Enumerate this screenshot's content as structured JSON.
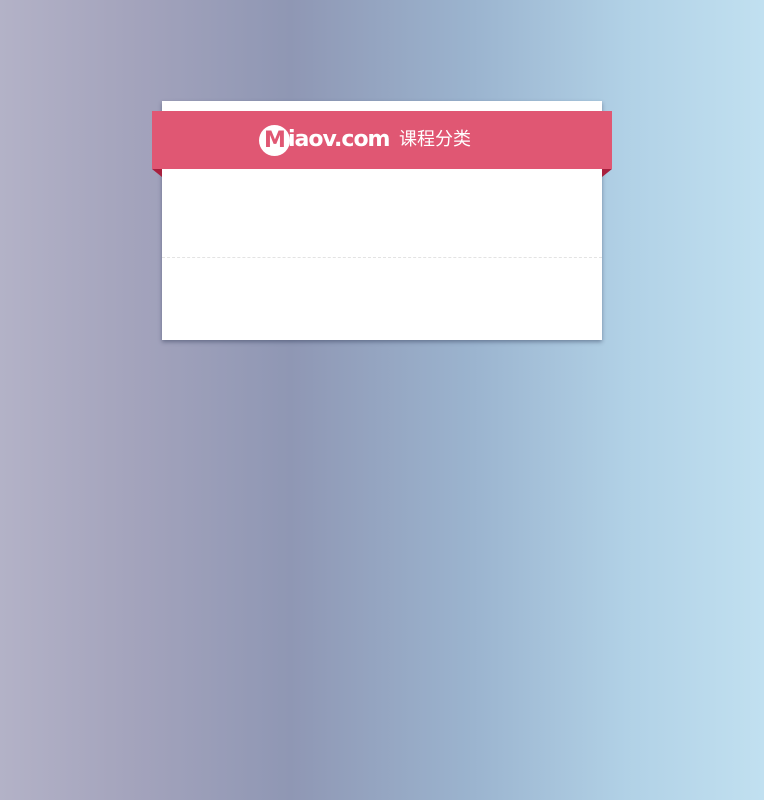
{
  "logo": {
    "initial": "M",
    "text": "iaov.com"
  },
  "header": {
    "title": "课程分类"
  },
  "colors": {
    "ribbon": "#e05773",
    "ribbon_fold": "#a8203e",
    "card": "#ffffff"
  },
  "icons": {
    "logo": "miaov-logo"
  }
}
